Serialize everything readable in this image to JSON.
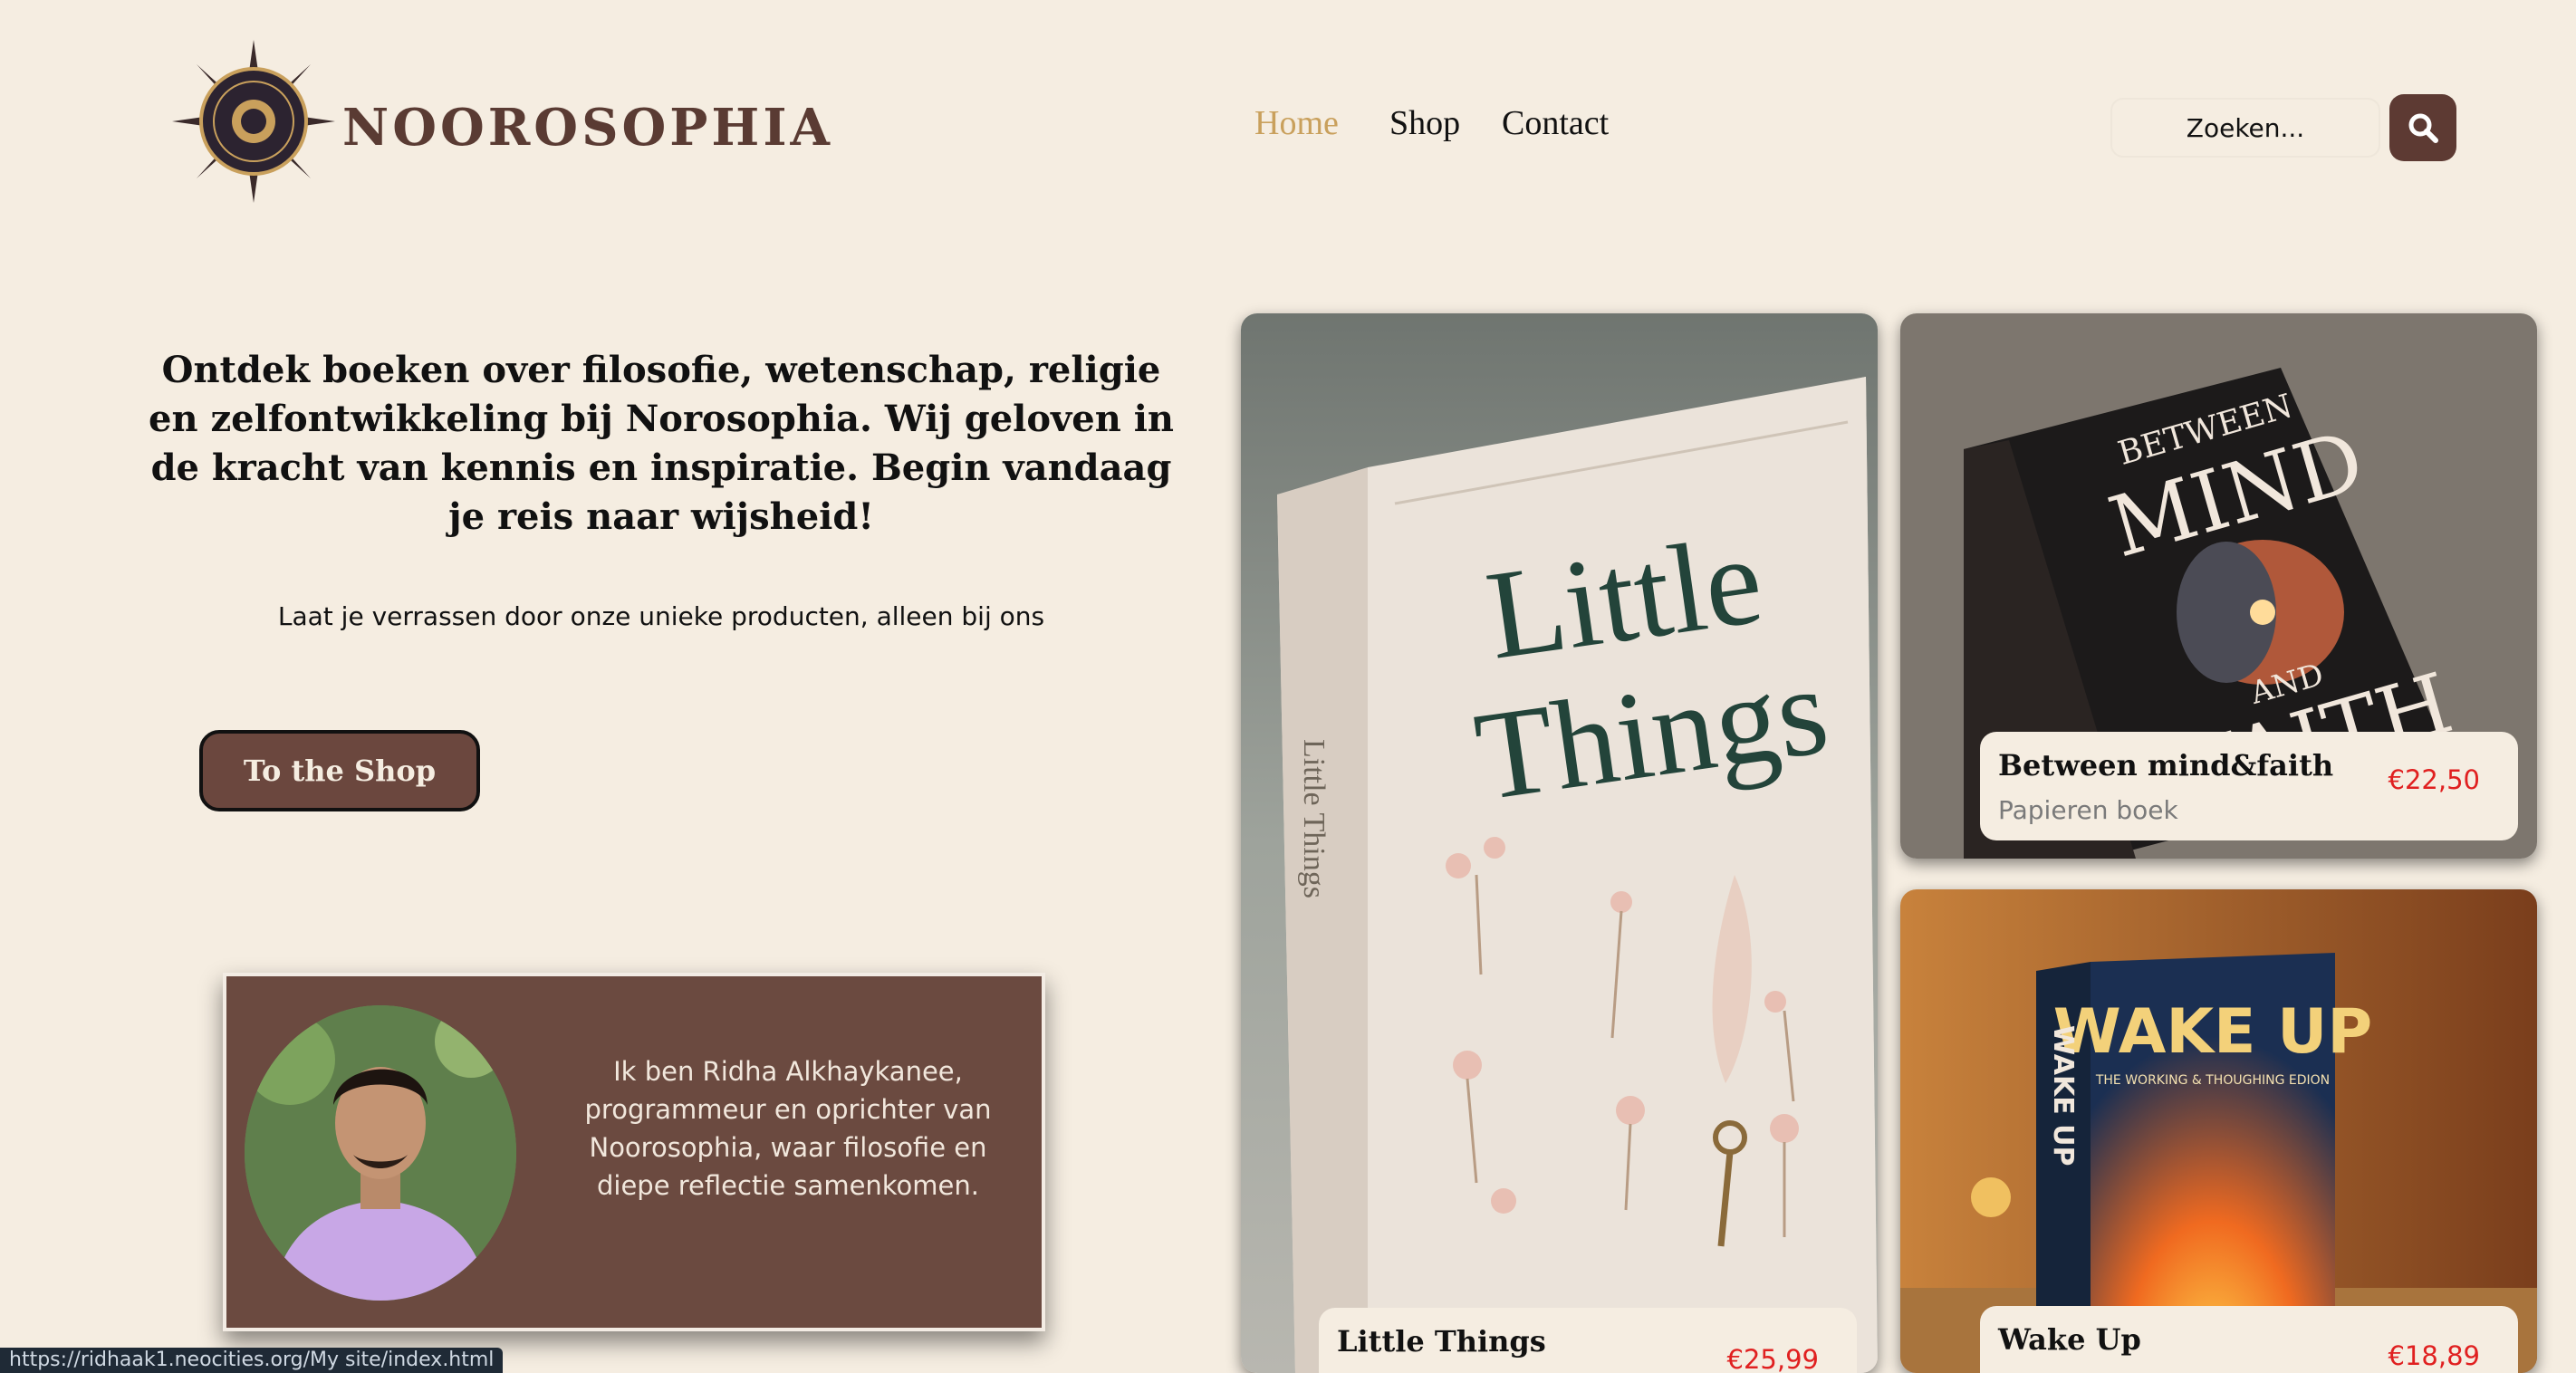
{
  "brand": {
    "name": "NOOROSOPHIA"
  },
  "nav": {
    "items": [
      {
        "label": "Home",
        "active": true
      },
      {
        "label": "Shop",
        "active": false
      },
      {
        "label": "Contact",
        "active": false
      }
    ]
  },
  "search": {
    "placeholder": "Zoeken...",
    "icon": "search-icon"
  },
  "hero": {
    "title": "Ontdek boeken over filosofie, wetenschap, religie en zelfontwikkeling bij Norosophia. Wij geloven in de kracht van kennis en inspiratie. Begin vandaag je reis naar wijsheid!",
    "subtitle": "Laat je verrassen door onze unieke producten, alleen bij ons",
    "cta": "To the Shop"
  },
  "founder": {
    "text": "Ik ben Ridha Alkhaykanee, programmeur en oprichter van Noorosophia, waar filosofie en diepe reflectie samenkomen."
  },
  "products": [
    {
      "name": "Little Things",
      "price": "€25,99",
      "cover_title_1": "Little",
      "cover_title_2": "Things",
      "spine": "Little Things"
    },
    {
      "name": "Between mind&faith",
      "type": "Papieren boek",
      "price": "€22,50",
      "cover_top": "BETWEEN",
      "cover_main": "MIND",
      "cover_and": "AND",
      "cover_bottom": "FAITH"
    },
    {
      "name": "Wake Up",
      "price": "€18,89",
      "cover_title": "WAKE UP",
      "cover_sub": "THE WORKING & THOUGHING EDION",
      "spine": "WAKE UP"
    }
  ],
  "status_bar": {
    "url": "https://ridhaak1.neocities.org/My site/index.html"
  },
  "colors": {
    "background": "#f5ede1",
    "brand_brown": "#5a3b33",
    "accent_gold": "#c9a05c",
    "price_red": "#e02020"
  }
}
